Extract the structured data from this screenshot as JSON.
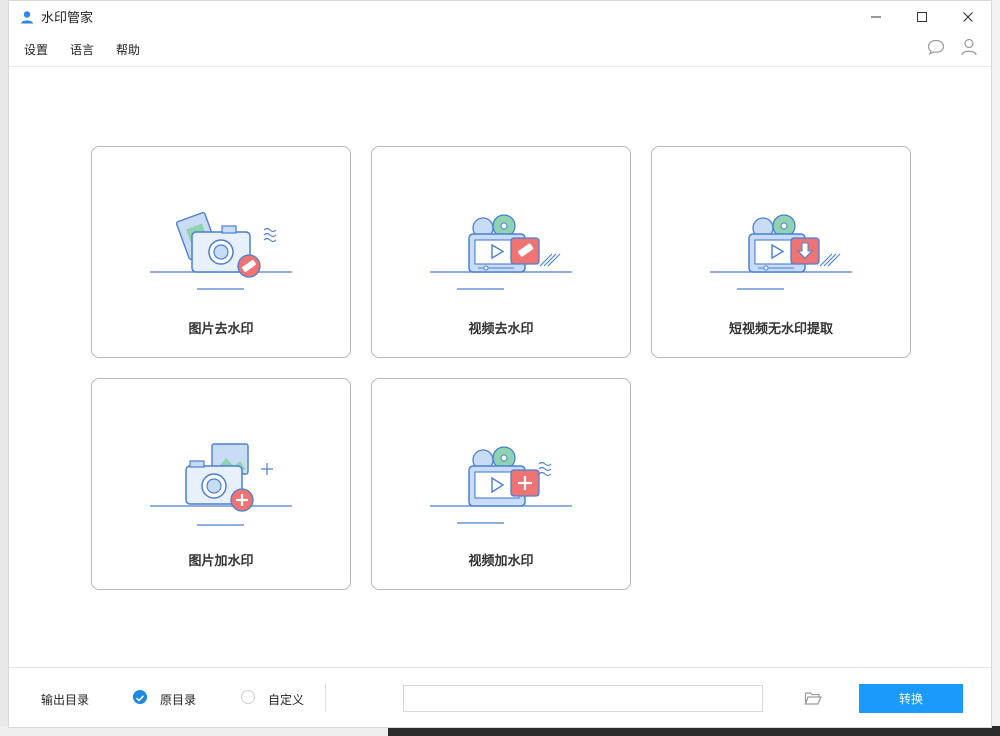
{
  "window": {
    "title": "水印管家",
    "icon": "user-icon"
  },
  "menu": {
    "items": [
      "设置",
      "语言",
      "帮助"
    ],
    "right_icons": [
      "chat-bubble-icon",
      "user-account-icon"
    ]
  },
  "cards": [
    {
      "label": "图片去水印",
      "icon": "camera-eraser-icon"
    },
    {
      "label": "视频去水印",
      "icon": "video-eraser-icon"
    },
    {
      "label": "短视频无水印提取",
      "icon": "video-download-icon"
    },
    {
      "label": "图片加水印",
      "icon": "camera-add-icon"
    },
    {
      "label": "视频加水印",
      "icon": "video-add-icon"
    }
  ],
  "footer": {
    "output_label": "输出目录",
    "options": [
      {
        "label": "原目录",
        "checked": true
      },
      {
        "label": "自定义",
        "checked": false
      }
    ],
    "path_value": "",
    "folder_icon": "folder-open-icon",
    "convert_label": "转换"
  },
  "colors": {
    "accent": "#1a9bfc",
    "radio_checked": "#1e88e5",
    "illus_blue": "#4a7fd4",
    "illus_light_blue": "#c9dcf5",
    "illus_red": "#f07373",
    "illus_green": "#8fd3b0"
  }
}
